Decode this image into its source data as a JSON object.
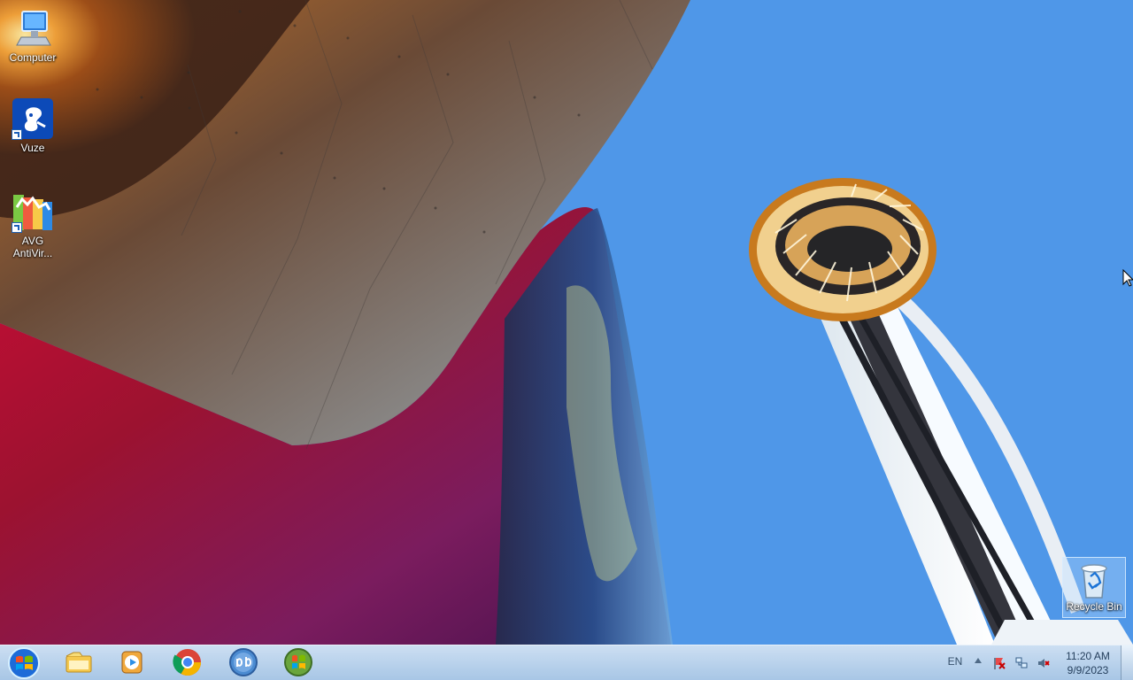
{
  "desktop": {
    "icons": [
      {
        "label": "Computer",
        "icon": "computer-icon"
      },
      {
        "label": "Vuze",
        "icon": "vuze-icon"
      },
      {
        "label": "AVG\nAntiVir...",
        "icon": "avg-antivirus-icon"
      }
    ],
    "recycle_bin": {
      "label": "Recycle Bin",
      "icon": "recycle-bin-icon"
    }
  },
  "taskbar": {
    "start_icon": "windows-start-icon",
    "pinned": [
      {
        "icon": "windows-explorer-icon"
      },
      {
        "icon": "windows-media-player-icon"
      },
      {
        "icon": "google-chrome-icon"
      },
      {
        "icon": "qbittorrent-icon"
      },
      {
        "icon": "game-explorer-icon"
      }
    ],
    "tray": {
      "language": "EN",
      "icons": [
        "show-hidden-icons-icon",
        "action-center-alert-icon",
        "network-icon",
        "volume-muted-icon"
      ]
    },
    "clock": {
      "time": "11:20 AM",
      "date": "9/9/2023"
    }
  },
  "colors": {
    "sky_blue": "#4f97e8",
    "taskbar": "#b9d2ea",
    "tower_orange": "#c87a1e"
  }
}
